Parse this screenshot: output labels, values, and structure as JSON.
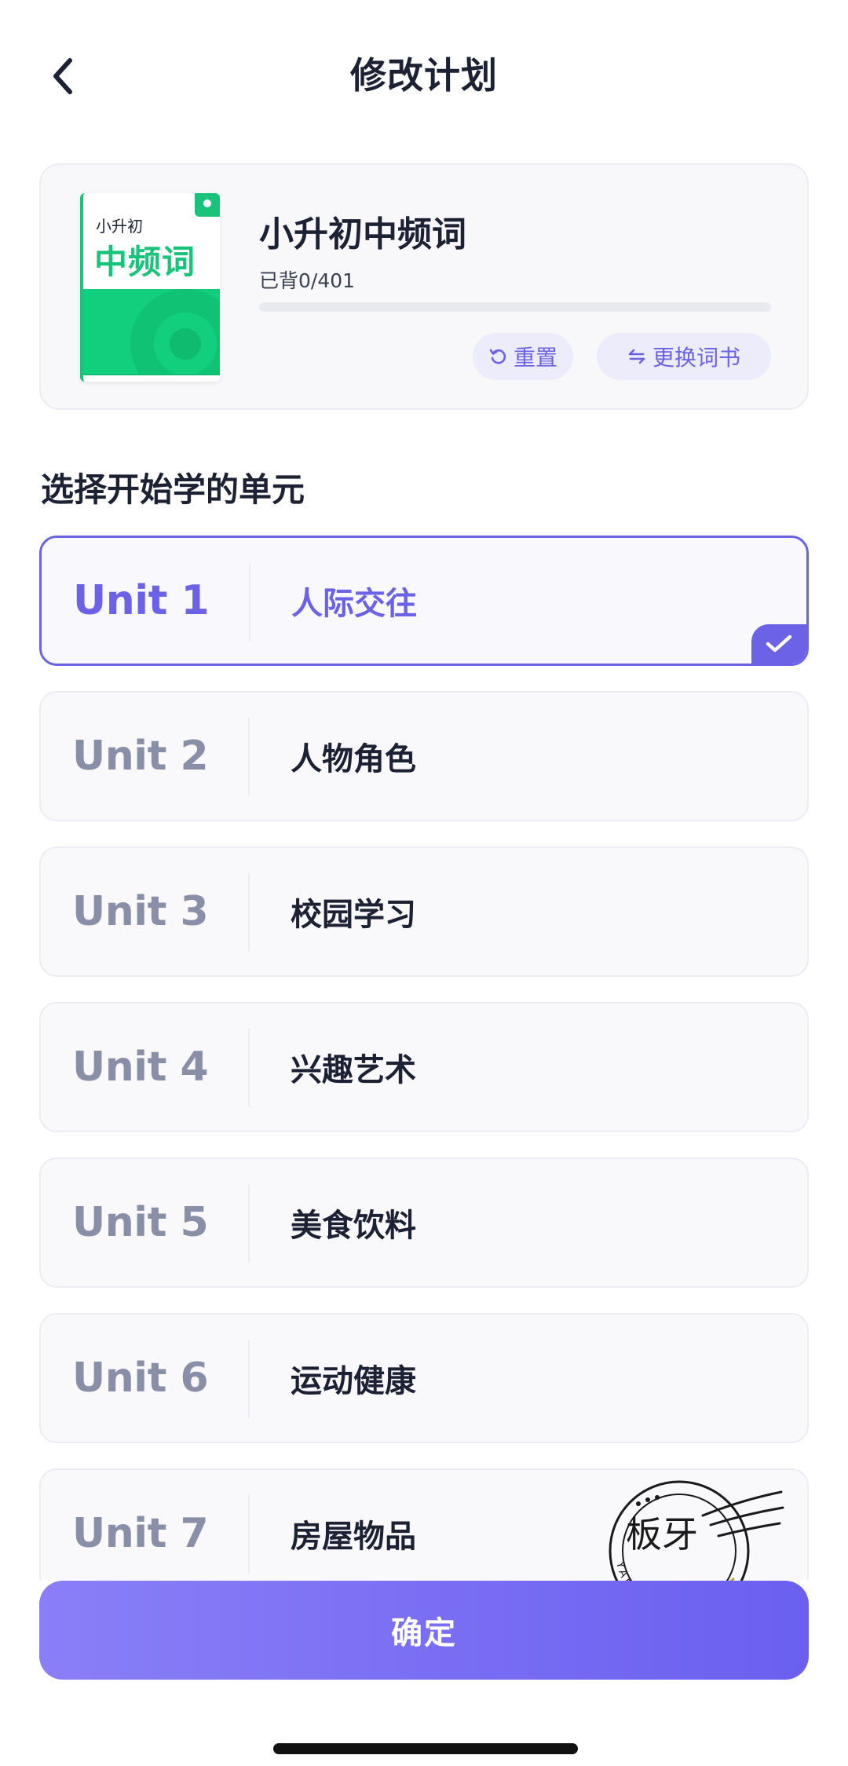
{
  "header": {
    "title": "修改计划"
  },
  "book": {
    "cover_subtitle": "小升初",
    "cover_title": "中频词",
    "name": "小升初中频词",
    "progress_text": "已背0/401",
    "progress_fraction": 0,
    "reset_label": "重置",
    "change_label": "更换词书"
  },
  "section_title": "选择开始学的单元",
  "units": [
    {
      "number": "Unit 1",
      "name": "人际交往",
      "selected": true
    },
    {
      "number": "Unit 2",
      "name": "人物角色",
      "selected": false
    },
    {
      "number": "Unit 3",
      "name": "校园学习",
      "selected": false
    },
    {
      "number": "Unit 4",
      "name": "兴趣艺术",
      "selected": false
    },
    {
      "number": "Unit 5",
      "name": "美食饮料",
      "selected": false
    },
    {
      "number": "Unit 6",
      "name": "运动健康",
      "selected": false
    },
    {
      "number": "Unit 7",
      "name": "房屋物品",
      "selected": false
    }
  ],
  "confirm_label": "确定",
  "stamp": {
    "text": "板牙",
    "arc_text": "YAMEDYAX"
  },
  "colors": {
    "accent": "#6c62e8",
    "cover_green": "#12cf7d",
    "card_bg": "#f9f9fc",
    "muted_unit": "#8a8fa8"
  }
}
